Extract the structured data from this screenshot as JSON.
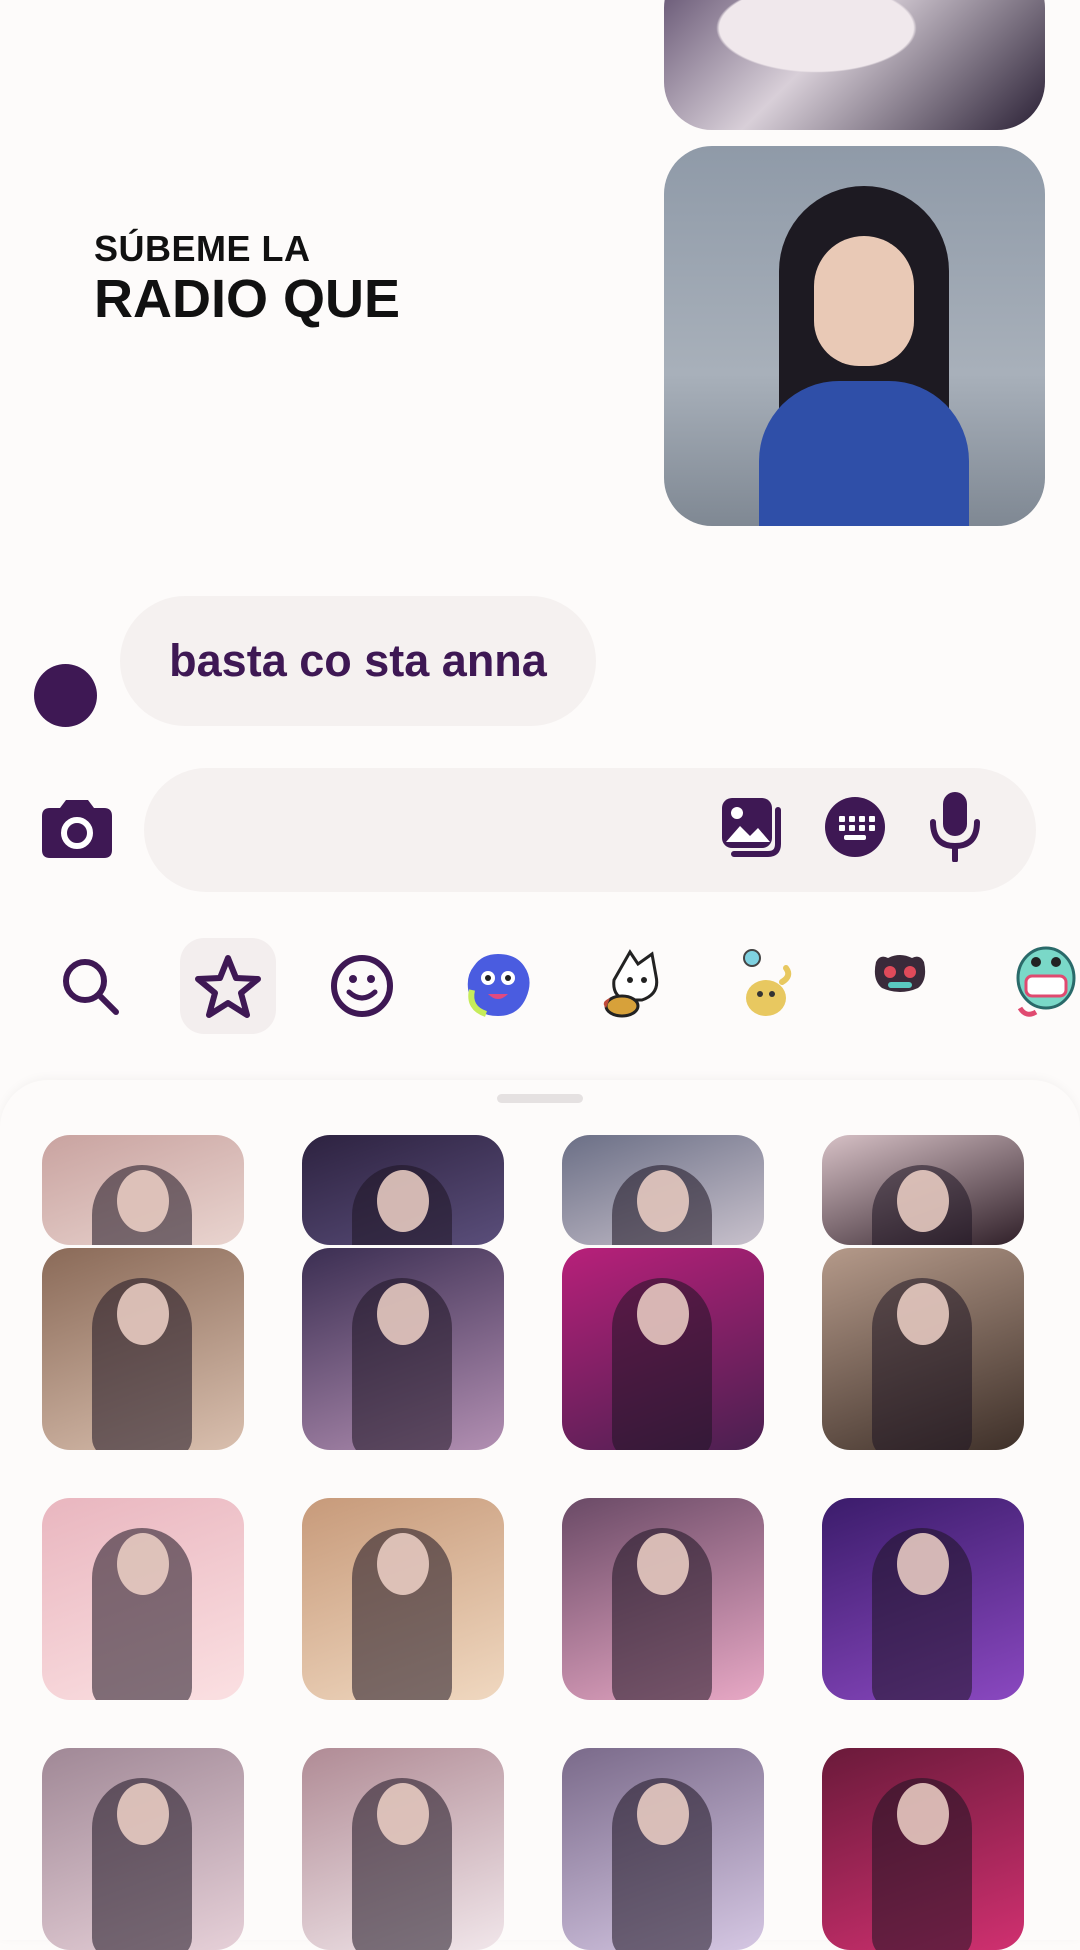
{
  "chat": {
    "lyric_line1": "SÚBEME LA",
    "lyric_line2": "RADIO QUE",
    "message_text": "basta co sta anna"
  },
  "input_bar": {
    "value": "",
    "icons": [
      "camera-icon",
      "gallery-icon",
      "keyboard-icon",
      "microphone-icon"
    ]
  },
  "sticker_tabs": [
    {
      "name": "search-icon",
      "selected": false
    },
    {
      "name": "star-icon",
      "selected": true
    },
    {
      "name": "smiley-icon",
      "selected": false
    },
    {
      "name": "blue-monster-sticker-icon",
      "selected": false
    },
    {
      "name": "dog-cat-sticker-icon",
      "selected": false
    },
    {
      "name": "yellow-blob-sticker-icon",
      "selected": false
    },
    {
      "name": "red-bug-sticker-icon",
      "selected": false
    },
    {
      "name": "green-monster-sticker-icon",
      "selected": false
    }
  ],
  "colors": {
    "accent": "#3e1854",
    "background": "#fdfbfa",
    "bubble": "#f5f1f0"
  },
  "gif_grid": {
    "tiles": [
      {
        "palette": [
          "#c9a3a0",
          "#e9d4cf"
        ]
      },
      {
        "palette": [
          "#2d2240",
          "#5a4e7a"
        ]
      },
      {
        "palette": [
          "#6b6f86",
          "#c8c1cc"
        ]
      },
      {
        "palette": [
          "#d7c1c6",
          "#302029"
        ]
      },
      {
        "palette": [
          "#8a6a58",
          "#d9bfae"
        ]
      },
      {
        "palette": [
          "#3b2e52",
          "#b28fb2"
        ]
      },
      {
        "palette": [
          "#b8207a",
          "#4a2050"
        ]
      },
      {
        "palette": [
          "#b59a8a",
          "#3e3029"
        ]
      },
      {
        "palette": [
          "#e9b6bf",
          "#fbe0e2"
        ]
      },
      {
        "palette": [
          "#c79a7a",
          "#f0d8c0"
        ]
      },
      {
        "palette": [
          "#6a4a66",
          "#e8a8c5"
        ]
      },
      {
        "palette": [
          "#3b1c6b",
          "#8a48c0"
        ]
      },
      {
        "palette": [
          "#a08896",
          "#e6d0d8"
        ]
      },
      {
        "palette": [
          "#b08b95",
          "#f1e6ea"
        ]
      },
      {
        "palette": [
          "#7a6a8a",
          "#d5c7e3"
        ]
      },
      {
        "palette": [
          "#6a1a3a",
          "#d03070"
        ]
      }
    ]
  }
}
